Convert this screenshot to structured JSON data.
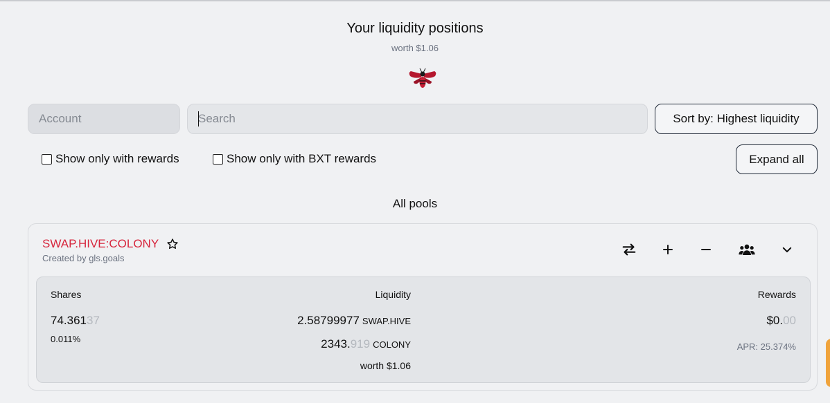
{
  "header": {
    "title": "Your liquidity positions",
    "worth": "worth $1.06"
  },
  "filters": {
    "account_placeholder": "Account",
    "search_placeholder": "Search",
    "sort_label": "Sort by: Highest liquidity",
    "show_rewards_label": "Show only with rewards",
    "show_bxt_label": "Show only with BXT rewards",
    "expand_all_label": "Expand all"
  },
  "section": {
    "title": "All pools"
  },
  "pool": {
    "name": "SWAP.HIVE:COLONY",
    "creator": "Created by gls.goals",
    "icons": [
      "star-icon",
      "swap-arrows-icon",
      "plus-icon",
      "minus-icon",
      "users-icon",
      "chevron-down-icon"
    ],
    "shares_label": "Shares",
    "shares_main": "74.361",
    "shares_faint": "37",
    "shares_pct": "0.011%",
    "liquidity_label": "Liquidity",
    "token1_amount": "2.58799977",
    "token1_symbol": "SWAP.HIVE",
    "token2_main": "2343.",
    "token2_faint": "919",
    "token2_symbol": "COLONY",
    "liquidity_worth": "worth $1.06",
    "rewards_label": "Rewards",
    "rewards_main": "$0.",
    "rewards_faint": "00",
    "apr": "APR: 25.374%"
  },
  "colors": {
    "pool_name": "#d7263d",
    "background": "#f0f1f3",
    "details_bg": "#e3e5e8",
    "faint_digits": "#b4b8be"
  }
}
